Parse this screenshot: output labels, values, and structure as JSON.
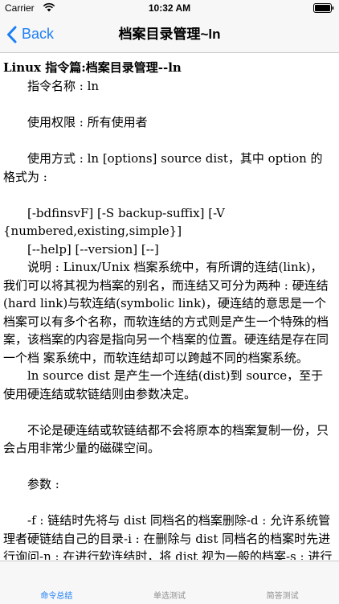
{
  "status_bar": {
    "carrier": "Carrier",
    "time": "10:32 AM"
  },
  "nav": {
    "back_label": "Back",
    "title": "档案目录管理~ln"
  },
  "content": {
    "heading": "Linux 指令篇:档案目录管理--ln",
    "paragraphs": [
      "　　指令名称 : ln",
      "",
      "　　使用权限 : 所有使用者",
      "",
      "　　使用方式 : ln [options] source dist，其中 option 的格式为 :",
      "",
      "　　[-bdfinsvF] [-S backup-suffix] [-V {numbered,existing,simple}]",
      "　　[--help] [--version] [--]",
      "　　说明 : Linux/Unix 档案系统中，有所谓的连结(link)，我们可以将其视为档案的别名，而连结又可分为两种 : 硬连结(hard link)与软连结(symbolic link)，硬连结的意思是一个档案可以有多个名称，而软连结的方式则是产生一个特殊的档案，该档案的内容是指向另一个档案的位置。硬连结是存在同一个档 案系统中，而软连结却可以跨越不同的档案系统。",
      "　　ln source dist 是产生一个连结(dist)到 source，至于使用硬连结或软链结则由参数决定。",
      "",
      "　　不论是硬连结或软链结都不会将原本的档案复制一份，只会占用非常少量的磁碟空间。",
      "",
      "　　参数 :",
      "",
      "　　-f : 链结时先将与 dist 同档名的档案删除-d : 允许系统管理者硬链结自己的目录-i : 在删除与 dist 同档名的档案时先进行询问-n : 在进行软连结时，将 dist 视为一般的档案-s : 进行软链结(symbolic link)-v : 在连结之前显示其档名-b : 将在链结时会被覆写或删除的档案进行备份-S SUFFIX : 将备份的档案都加上 SUFFIX 的字尾"
    ]
  },
  "tabs": [
    {
      "label": "命令总结",
      "active": true
    },
    {
      "label": "单选测试",
      "active": false
    },
    {
      "label": "简答测试",
      "active": false
    }
  ],
  "colors": {
    "accent": "#1b7ff5",
    "bar_bg": "#f7f7f7"
  }
}
